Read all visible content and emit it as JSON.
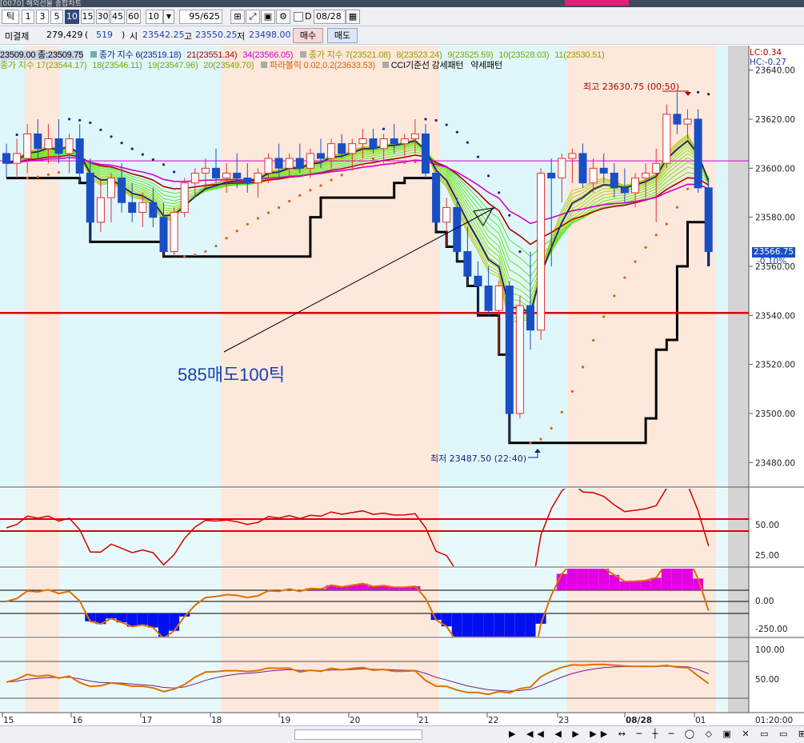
{
  "topbar": {
    "title": "[0070] 해외선물 종합차트"
  },
  "toolbar": {
    "tick_label": "틱",
    "intervals": [
      "1",
      "3",
      "5",
      "10",
      "15",
      "30",
      "45",
      "60"
    ],
    "interval_selected": "10",
    "interval_combo": "10",
    "count_value": "95",
    "count_total": "/625",
    "date_value": "08/28",
    "date_prefix": "D"
  },
  "quote_bar": {
    "open_interest_label": "미결제",
    "open_interest_value": "279,429",
    "paren_open": "(",
    "open_interest_change": "519",
    "paren_close": ")",
    "open_label": "시",
    "open_value": "23542.25",
    "high_label": "고",
    "high_value": "23550.25",
    "low_label": "저",
    "low_value": "23498.00",
    "buy_label": "매수",
    "sell_label": "매도"
  },
  "legend_row1": {
    "ohlc": "23509.00 종:23509.75",
    "ma1_label": "종가 지수 6(23519.18)",
    "ma1_color": "#1a237e",
    "ma2_label": "21(23551.34)",
    "ma2_color": "#b00000",
    "ma3_label": "34(23566.05)",
    "ma3_color": "#d000d0",
    "ma4_label": "종가 지수 7(23521.08)",
    "ma4_color": "#9a9a00",
    "ma5_label": "8(23523.24)",
    "ma6_label": "9(23525.59)",
    "ma7_label": "10(23528.03)",
    "ma8_label": "11(23530.51)"
  },
  "legend_row2": {
    "ma9_label": "종가 지수 17(23544.17)",
    "ma10_label": "18(23546.11)",
    "ma11_label": "19(23547.96)",
    "ma12_label": "20(23549.70)",
    "sar_label": "파라볼릭 0.02,0.2(23633.53)",
    "sar_color": "#e06000",
    "cci_label": "CCI기준선 강세패턴",
    "weak_label": "약세패턴"
  },
  "side_info": {
    "lc": "LC:0.34",
    "hc": "HC:-0.27",
    "price_label": "23566.75",
    "pct_label": "-0.10%"
  },
  "annotations": {
    "high": "최고 23630.75 (00:50)",
    "low": "최저 23487.50 (22:40)",
    "note": "585매도100틱"
  },
  "price_axis": {
    "ticks": [
      "23640.00",
      "23620.00",
      "23600.00",
      "23580.00",
      "23560.00",
      "23540.00",
      "23520.00",
      "23500.00",
      "23480.00"
    ]
  },
  "ind1_axis": {
    "ticks": [
      "50.00",
      "25.00"
    ]
  },
  "ind2_axis": {
    "ticks": [
      "0.00",
      "-250.00"
    ]
  },
  "ind3_axis": {
    "ticks": [
      "100.00",
      "50.00"
    ]
  },
  "time_axis": {
    "labels": [
      "15",
      "16",
      "17",
      "18",
      "19",
      "20",
      "21",
      "22",
      "23",
      "08/28",
      "01"
    ],
    "right_label": "01:20:00"
  },
  "colors": {
    "bg_shade": "#dff7fb",
    "session_shade": "#fde8dc",
    "up": "#e03030",
    "down": "#1a4fc4",
    "support": "#e00000"
  },
  "chart_data": {
    "type": "candlestick",
    "price_range": [
      23470,
      23650
    ],
    "support_line": 23541,
    "high": {
      "value": 23630.75,
      "time": "00:50"
    },
    "low": {
      "value": 23487.5,
      "time": "22:40"
    },
    "candles": [
      {
        "o": 23606,
        "h": 23610,
        "l": 23596,
        "c": 23602
      },
      {
        "o": 23602,
        "h": 23612,
        "l": 23596,
        "c": 23606
      },
      {
        "o": 23604,
        "h": 23618,
        "l": 23598,
        "c": 23614
      },
      {
        "o": 23614,
        "h": 23620,
        "l": 23604,
        "c": 23608
      },
      {
        "o": 23608,
        "h": 23618,
        "l": 23602,
        "c": 23612
      },
      {
        "o": 23612,
        "h": 23620,
        "l": 23602,
        "c": 23606
      },
      {
        "o": 23606,
        "h": 23614,
        "l": 23598,
        "c": 23612
      },
      {
        "o": 23612,
        "h": 23618,
        "l": 23594,
        "c": 23598
      },
      {
        "o": 23598,
        "h": 23604,
        "l": 23570,
        "c": 23578
      },
      {
        "o": 23578,
        "h": 23596,
        "l": 23574,
        "c": 23588
      },
      {
        "o": 23588,
        "h": 23598,
        "l": 23578,
        "c": 23596
      },
      {
        "o": 23596,
        "h": 23602,
        "l": 23582,
        "c": 23586
      },
      {
        "o": 23586,
        "h": 23594,
        "l": 23578,
        "c": 23582
      },
      {
        "o": 23582,
        "h": 23590,
        "l": 23576,
        "c": 23586
      },
      {
        "o": 23586,
        "h": 23592,
        "l": 23576,
        "c": 23580
      },
      {
        "o": 23580,
        "h": 23586,
        "l": 23564,
        "c": 23566
      },
      {
        "o": 23566,
        "h": 23584,
        "l": 23564,
        "c": 23582
      },
      {
        "o": 23582,
        "h": 23596,
        "l": 23580,
        "c": 23594
      },
      {
        "o": 23594,
        "h": 23600,
        "l": 23588,
        "c": 23598
      },
      {
        "o": 23598,
        "h": 23604,
        "l": 23592,
        "c": 23600
      },
      {
        "o": 23600,
        "h": 23608,
        "l": 23594,
        "c": 23596
      },
      {
        "o": 23596,
        "h": 23602,
        "l": 23590,
        "c": 23598
      },
      {
        "o": 23598,
        "h": 23606,
        "l": 23592,
        "c": 23596
      },
      {
        "o": 23596,
        "h": 23602,
        "l": 23590,
        "c": 23594
      },
      {
        "o": 23594,
        "h": 23600,
        "l": 23588,
        "c": 23598
      },
      {
        "o": 23598,
        "h": 23606,
        "l": 23594,
        "c": 23604
      },
      {
        "o": 23604,
        "h": 23610,
        "l": 23596,
        "c": 23600
      },
      {
        "o": 23600,
        "h": 23606,
        "l": 23596,
        "c": 23604
      },
      {
        "o": 23604,
        "h": 23610,
        "l": 23598,
        "c": 23600
      },
      {
        "o": 23600,
        "h": 23608,
        "l": 23596,
        "c": 23606
      },
      {
        "o": 23606,
        "h": 23612,
        "l": 23600,
        "c": 23604
      },
      {
        "o": 23604,
        "h": 23612,
        "l": 23600,
        "c": 23610
      },
      {
        "o": 23610,
        "h": 23614,
        "l": 23604,
        "c": 23606
      },
      {
        "o": 23606,
        "h": 23612,
        "l": 23600,
        "c": 23610
      },
      {
        "o": 23610,
        "h": 23616,
        "l": 23604,
        "c": 23612
      },
      {
        "o": 23612,
        "h": 23616,
        "l": 23606,
        "c": 23608
      },
      {
        "o": 23608,
        "h": 23614,
        "l": 23602,
        "c": 23612
      },
      {
        "o": 23612,
        "h": 23618,
        "l": 23606,
        "c": 23610
      },
      {
        "o": 23610,
        "h": 23614,
        "l": 23604,
        "c": 23612
      },
      {
        "o": 23612,
        "h": 23620,
        "l": 23606,
        "c": 23614
      },
      {
        "o": 23614,
        "h": 23618,
        "l": 23596,
        "c": 23598
      },
      {
        "o": 23598,
        "h": 23600,
        "l": 23574,
        "c": 23578
      },
      {
        "o": 23578,
        "h": 23588,
        "l": 23568,
        "c": 23584
      },
      {
        "o": 23584,
        "h": 23588,
        "l": 23562,
        "c": 23566
      },
      {
        "o": 23566,
        "h": 23576,
        "l": 23552,
        "c": 23556
      },
      {
        "o": 23556,
        "h": 23562,
        "l": 23540,
        "c": 23552
      },
      {
        "o": 23552,
        "h": 23560,
        "l": 23540,
        "c": 23542
      },
      {
        "o": 23542,
        "h": 23554,
        "l": 23524,
        "c": 23552
      },
      {
        "o": 23552,
        "h": 23554,
        "l": 23488,
        "c": 23500
      },
      {
        "o": 23500,
        "h": 23548,
        "l": 23498,
        "c": 23544
      },
      {
        "o": 23544,
        "h": 23566,
        "l": 23526,
        "c": 23534
      },
      {
        "o": 23534,
        "h": 23600,
        "l": 23530,
        "c": 23598
      },
      {
        "o": 23598,
        "h": 23604,
        "l": 23560,
        "c": 23596
      },
      {
        "o": 23596,
        "h": 23606,
        "l": 23586,
        "c": 23604
      },
      {
        "o": 23604,
        "h": 23608,
        "l": 23594,
        "c": 23606
      },
      {
        "o": 23606,
        "h": 23610,
        "l": 23592,
        "c": 23594
      },
      {
        "o": 23594,
        "h": 23604,
        "l": 23590,
        "c": 23600
      },
      {
        "o": 23600,
        "h": 23606,
        "l": 23594,
        "c": 23598
      },
      {
        "o": 23598,
        "h": 23602,
        "l": 23588,
        "c": 23592
      },
      {
        "o": 23592,
        "h": 23600,
        "l": 23586,
        "c": 23590
      },
      {
        "o": 23590,
        "h": 23598,
        "l": 23584,
        "c": 23596
      },
      {
        "o": 23596,
        "h": 23602,
        "l": 23588,
        "c": 23598
      },
      {
        "o": 23598,
        "h": 23608,
        "l": 23578,
        "c": 23602
      },
      {
        "o": 23602,
        "h": 23626,
        "l": 23600,
        "c": 23622
      },
      {
        "o": 23622,
        "h": 23631,
        "l": 23614,
        "c": 23618
      },
      {
        "o": 23618,
        "h": 23624,
        "l": 23612,
        "c": 23620
      },
      {
        "o": 23620,
        "h": 23624,
        "l": 23590,
        "c": 23592
      },
      {
        "o": 23592,
        "h": 23596,
        "l": 23560,
        "c": 23566
      }
    ]
  }
}
